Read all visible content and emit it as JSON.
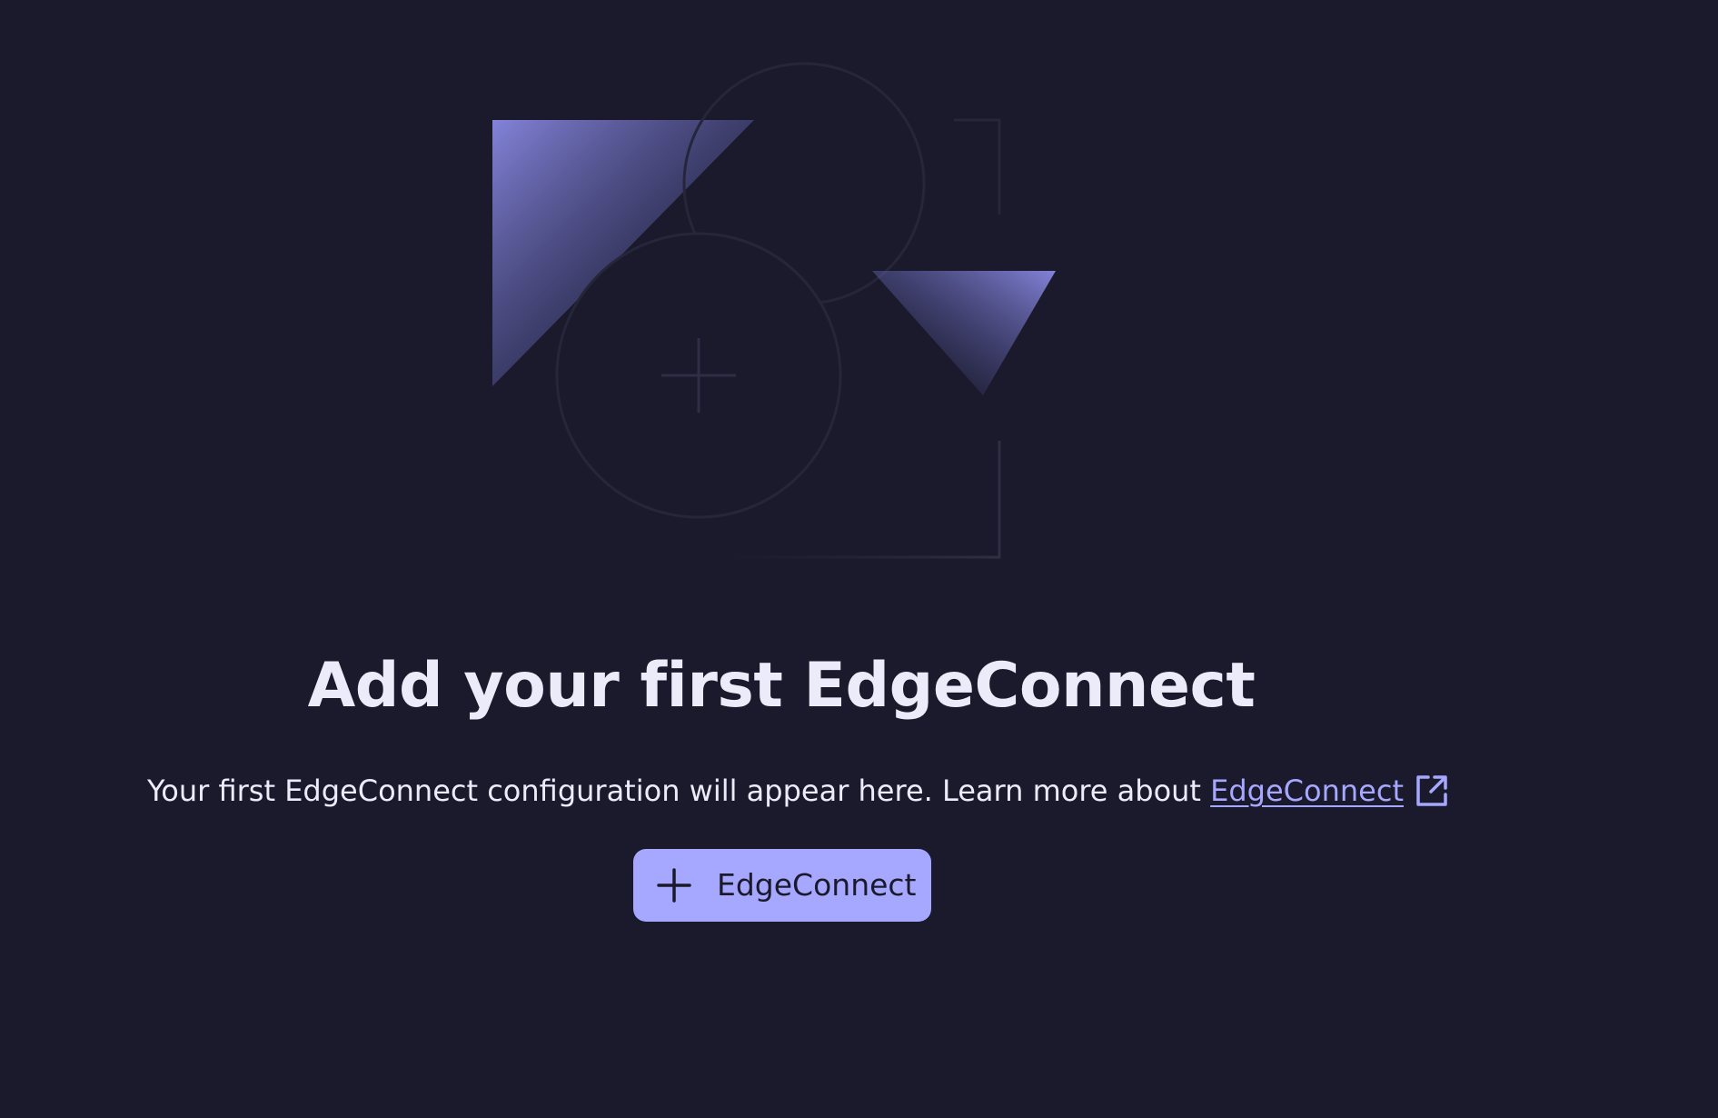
{
  "empty_state": {
    "title": "Add your first EdgeConnect",
    "description_text": "Your first EdgeConnect configuration will appear here. Learn more about ",
    "link_text": "EdgeConnect",
    "link_icon": "external-link-icon",
    "add_button": {
      "icon": "plus-icon",
      "label": "EdgeConnect"
    }
  },
  "colors": {
    "background": "#1a1a2c",
    "text": "#ebebfa",
    "accent": "#a6a8ff",
    "button_text": "#1a1a2c"
  }
}
